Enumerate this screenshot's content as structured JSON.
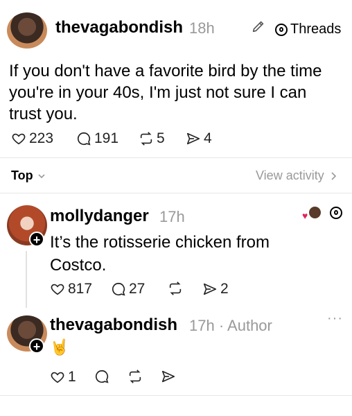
{
  "post": {
    "username": "thevagabondish",
    "time": "18h",
    "threads_label": "Threads",
    "text_line1": "If you don't have a favorite bird by the time",
    "text_line2": "you're in your 40s, I'm just not sure I can",
    "text_line3": "trust you.",
    "likes": "223",
    "replies": "191",
    "reposts": "5",
    "shares": "4"
  },
  "sort": {
    "label": "Top",
    "view_activity": "View activity"
  },
  "reply1": {
    "username": "mollydanger",
    "time": "17h",
    "text_line1": "It’s the rotisserie chicken from",
    "text_line2": "Costco.",
    "likes": "817",
    "replies": "27",
    "shares": "2"
  },
  "reply2": {
    "username": "thevagabondish",
    "meta": "17h · Author",
    "emoji": "🤘",
    "likes": "1",
    "more": "···"
  },
  "colors": {
    "text": "#000000",
    "muted": "#999999",
    "divider": "#e6e6e6",
    "heart": "#e0245e"
  }
}
